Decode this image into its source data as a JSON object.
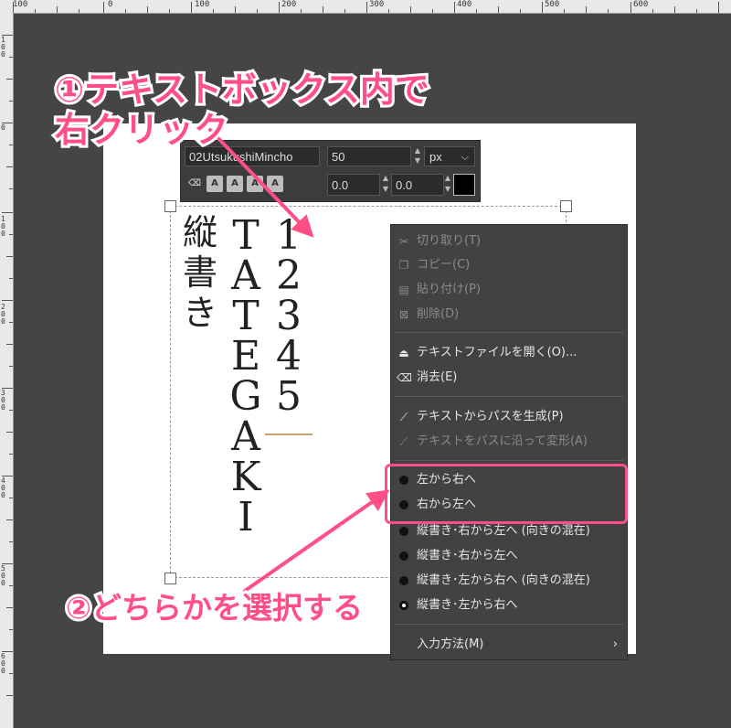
{
  "ruler": {
    "top_labels": [
      "100",
      "0",
      "100",
      "200",
      "300",
      "400",
      "500",
      "600"
    ],
    "left_labels": [
      "100",
      "0",
      "100",
      "200",
      "300",
      "400",
      "500",
      "600"
    ]
  },
  "style_editor": {
    "font_name": "02UtsukushiMincho",
    "font_size": "50",
    "unit": "px",
    "baseline_value": "0.0",
    "kerning_value": "0.0",
    "format_buttons": [
      "A",
      "A",
      "A",
      "A"
    ],
    "color_hex": "#000000"
  },
  "text_content": {
    "jp_column": [
      "縦",
      "書",
      "き"
    ],
    "latin_column": [
      "T",
      "A",
      "T",
      "E",
      "G",
      "A",
      "K",
      "I"
    ],
    "digit_column": [
      "1",
      "2",
      "3",
      "4",
      "5"
    ]
  },
  "context_menu": {
    "items": [
      {
        "label": "切り取り(T)",
        "icon": "scissors-icon",
        "enabled": false
      },
      {
        "label": "コピー(C)",
        "icon": "copy-icon",
        "enabled": false
      },
      {
        "label": "貼り付け(P)",
        "icon": "paste-icon",
        "enabled": false
      },
      {
        "label": "削除(D)",
        "icon": "delete-icon",
        "enabled": false
      },
      {
        "label": "テキストファイルを開く(O)...",
        "icon": "open-file-icon",
        "enabled": true
      },
      {
        "label": "消去(E)",
        "icon": "clear-icon",
        "enabled": true
      },
      {
        "label": "テキストからパスを生成(P)",
        "icon": "path-icon",
        "enabled": true
      },
      {
        "label": "テキストをパスに沿って変形(A)",
        "icon": "path-warp-icon",
        "enabled": false
      },
      {
        "label": "左から右へ",
        "icon": "radio",
        "enabled": true
      },
      {
        "label": "右から左へ",
        "icon": "radio",
        "enabled": true
      },
      {
        "label": "縦書き･右から左へ (向きの混在)",
        "icon": "radio",
        "enabled": true
      },
      {
        "label": "縦書き･右から左へ",
        "icon": "radio",
        "enabled": true
      },
      {
        "label": "縦書き･左から右へ (向きの混在)",
        "icon": "radio",
        "enabled": true
      },
      {
        "label": "縦書き･左から右へ",
        "icon": "radio-checked",
        "enabled": true
      },
      {
        "label": "入力方法(M)",
        "icon": "chevron-right-icon",
        "enabled": true
      }
    ]
  },
  "annotations": {
    "step1_line1": "①テキストボックス内で",
    "step1_line2": "右クリック",
    "step2": "②どちらかを選択する",
    "accent_color": "#ff4f86"
  }
}
